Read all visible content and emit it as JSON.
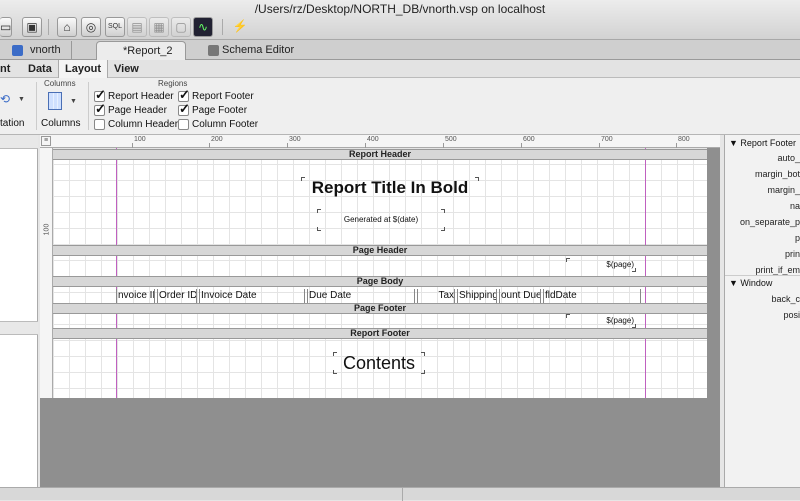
{
  "window": {
    "title": "/Users/rz/Desktop/NORTH_DB/vnorth.vsp on localhost"
  },
  "toolbar": {
    "icons": [
      "folder-icon",
      "save-icon",
      "home-icon",
      "globe-icon",
      "sql-icon",
      "document-icon",
      "grid-icon",
      "table-icon",
      "monitor-icon",
      "connect-icon"
    ]
  },
  "doc_tabs": [
    {
      "label": "vnorth",
      "color": "#3b6cc7"
    },
    {
      "label": "*Report_2",
      "color": ""
    },
    {
      "label": "Schema Editor",
      "color": "#777777"
    }
  ],
  "ribbon_tabs": [
    {
      "label": "nt"
    },
    {
      "label": "Data"
    },
    {
      "label": "Layout"
    },
    {
      "label": "View"
    }
  ],
  "ribbon": {
    "orientation_label": "tation",
    "columns_group_title": "Columns",
    "columns_button": "Columns",
    "regions_title": "Regions",
    "regions": [
      {
        "label": "Report Header",
        "checked": true
      },
      {
        "label": "Report Footer",
        "checked": true
      },
      {
        "label": "Page Header",
        "checked": true
      },
      {
        "label": "Page Footer",
        "checked": true
      },
      {
        "label": "Column Header",
        "checked": false
      },
      {
        "label": "Column Footer",
        "checked": false
      }
    ]
  },
  "ruler": {
    "labels": [
      "100",
      "200",
      "300",
      "400",
      "500",
      "600",
      "700",
      "800"
    ]
  },
  "vruler": {
    "label": "100"
  },
  "report": {
    "bands": {
      "report_header": "Report Header",
      "page_header": "Page Header",
      "page_body": "Page Body",
      "page_footer": "Page Footer",
      "report_footer": "Report Footer"
    },
    "title": "Report Title In Bold",
    "generated": "Generated at $(date)",
    "page_var_header": "$(page)",
    "page_var_footer": "$(page)",
    "contents": "Contents",
    "fields": [
      "nvoice ID",
      "Order ID",
      "Invoice Date",
      "Due Date",
      "Tax",
      "Shipping",
      "ount Due",
      "fldDate"
    ]
  },
  "properties": {
    "section1_title": "Report Footer",
    "section1_props": [
      "auto_",
      "margin_bot",
      "margin_",
      "na",
      "on_separate_p",
      "p",
      "prin",
      "print_if_em"
    ],
    "section2_title": "Window",
    "section2_props": [
      "back_c",
      "posi"
    ]
  }
}
